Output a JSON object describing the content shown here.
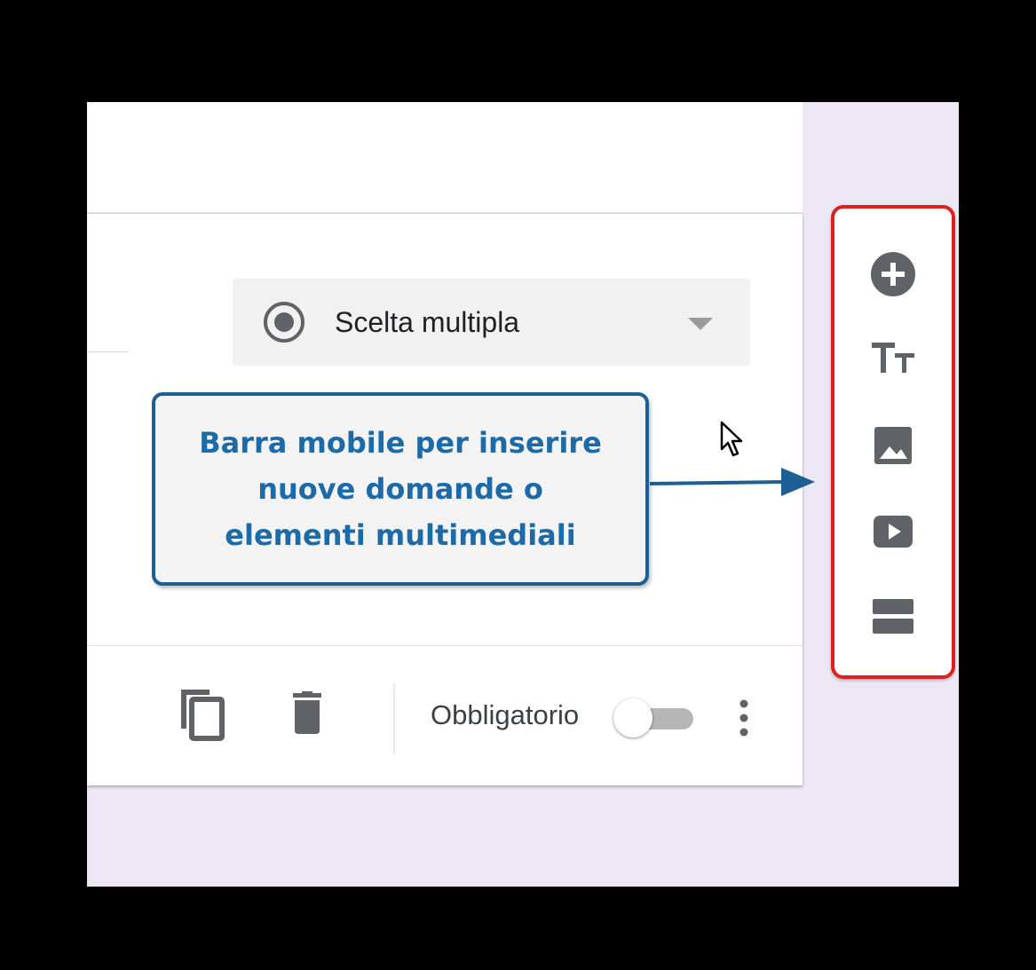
{
  "question": {
    "type_select": {
      "value": "Scelta multipla",
      "icon": "radio-button-checked-icon"
    },
    "footer": {
      "copy_icon": "content-copy-icon",
      "delete_icon": "trash-icon",
      "required_label": "Obbligatorio",
      "required_on": false,
      "more_icon": "more-vert-icon"
    }
  },
  "toolbar": {
    "items": [
      {
        "icon": "add-circle-icon"
      },
      {
        "icon": "title-text-icon"
      },
      {
        "icon": "image-icon"
      },
      {
        "icon": "video-play-icon"
      },
      {
        "icon": "section-icon"
      }
    ],
    "highlight_color": "#e01f1f"
  },
  "annotation": {
    "lines": [
      "Barra mobile per inserire",
      "nuove domande o",
      "elementi multimediali"
    ],
    "color": "#1d6aa8"
  },
  "colors": {
    "background": "#ede6f5",
    "card": "#ffffff",
    "icon": "#5f6368"
  }
}
